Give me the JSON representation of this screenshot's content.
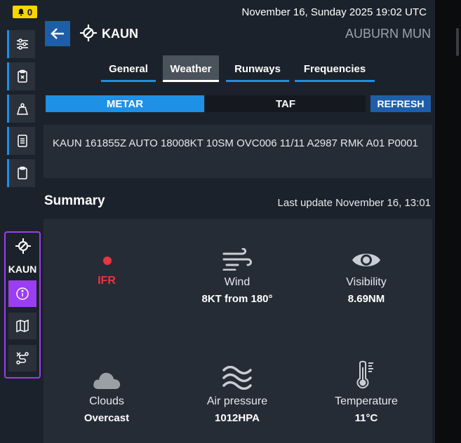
{
  "notification": {
    "count": "0"
  },
  "header": {
    "datetime": "November 16, Sunday 2025 19:02 UTC",
    "airport_code": "KAUN",
    "airport_name": "AUBURN MUN"
  },
  "tabs": [
    {
      "label": "General",
      "active": false
    },
    {
      "label": "Weather",
      "active": true
    },
    {
      "label": "Runways",
      "active": false
    },
    {
      "label": "Frequencies",
      "active": false
    }
  ],
  "report_toggle": {
    "metar": "METAR",
    "taf": "TAF",
    "selected": "METAR"
  },
  "refresh_label": "REFRESH",
  "metar_text": "KAUN 161855Z AUTO 18008KT 10SM OVC006 11/11 A2987 RMK A01 P0001",
  "summary": {
    "title": "Summary",
    "last_update": "Last update November 16, 13:01",
    "flight_category": "IFR",
    "wind": {
      "label": "Wind",
      "value": "8KT from 180°"
    },
    "visibility": {
      "label": "Visibility",
      "value": "8.69NM"
    },
    "clouds": {
      "label": "Clouds",
      "value": "Overcast"
    },
    "pressure": {
      "label": "Air pressure",
      "value": "1012HPA"
    },
    "temperature": {
      "label": "Temperature",
      "value": "11°C"
    }
  },
  "sidebar": {
    "airport_label": "KAUN",
    "icons": [
      "sliders-icon",
      "clipboard-x-icon",
      "weight-icon",
      "document-icon",
      "clipboard-icon"
    ],
    "airport_icons": [
      "info-icon",
      "map-icon",
      "route-icon"
    ]
  },
  "colors": {
    "accent_blue": "#1e90e6",
    "button_blue": "#1e5ea8",
    "airport_group_purple": "#9b3df0",
    "ifr_red": "#e8363e",
    "notification_yellow": "#f5d600"
  }
}
